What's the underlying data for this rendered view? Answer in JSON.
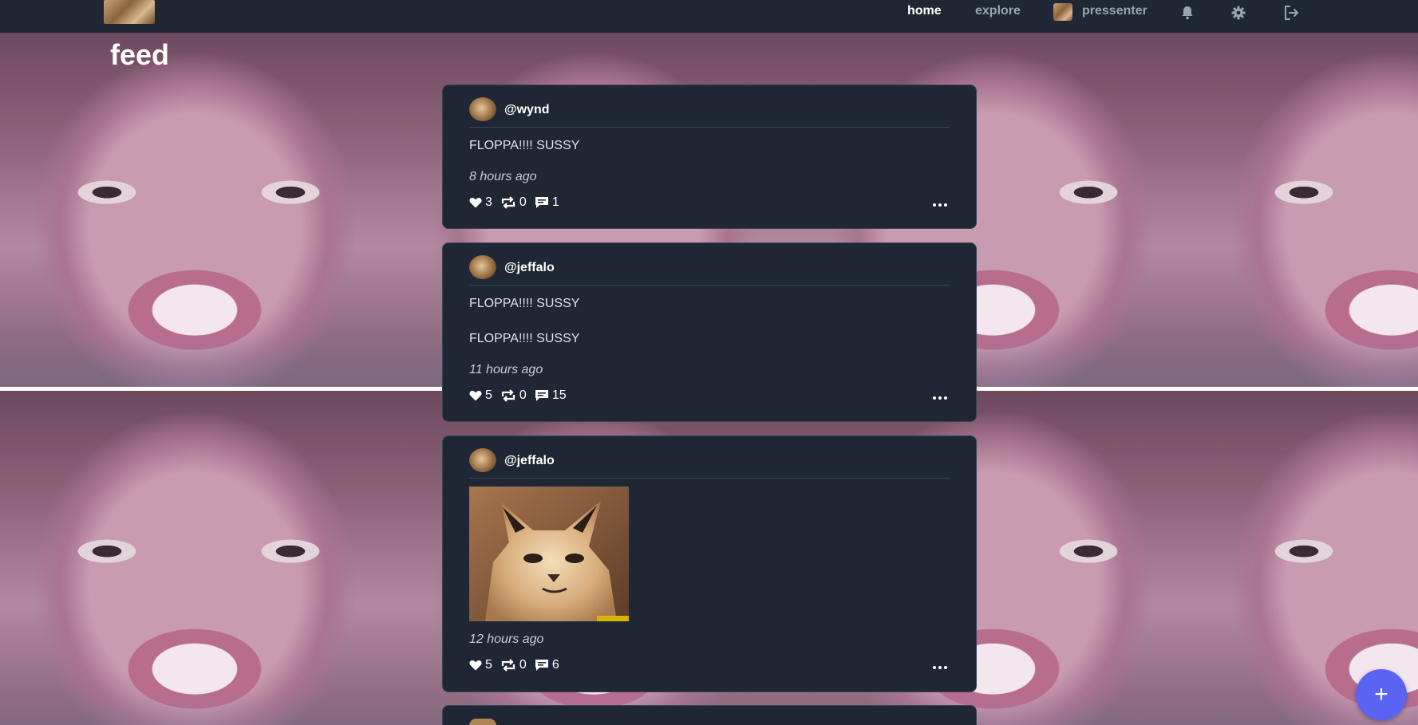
{
  "nav": {
    "home_label": "home",
    "explore_label": "explore",
    "username": "pressenter"
  },
  "page": {
    "title": "feed"
  },
  "posts": [
    {
      "handle": "@wynd",
      "paragraphs": [
        "FLOPPA!!!! SUSSY"
      ],
      "time": "8 hours ago",
      "likes": "3",
      "reposts": "0",
      "comments": "1"
    },
    {
      "handle": "@jeffalo",
      "paragraphs": [
        "FLOPPA!!!! SUSSY",
        "FLOPPA!!!! SUSSY"
      ],
      "time": "11 hours ago",
      "likes": "5",
      "reposts": "0",
      "comments": "15"
    },
    {
      "handle": "@jeffalo",
      "paragraphs": [],
      "has_image": true,
      "time": "12 hours ago",
      "likes": "5",
      "reposts": "0",
      "comments": "6"
    }
  ],
  "fab": {
    "label": "+"
  },
  "colors": {
    "topbar": "#1e2733",
    "card": "#1e2733",
    "accent": "#5b63f2"
  }
}
